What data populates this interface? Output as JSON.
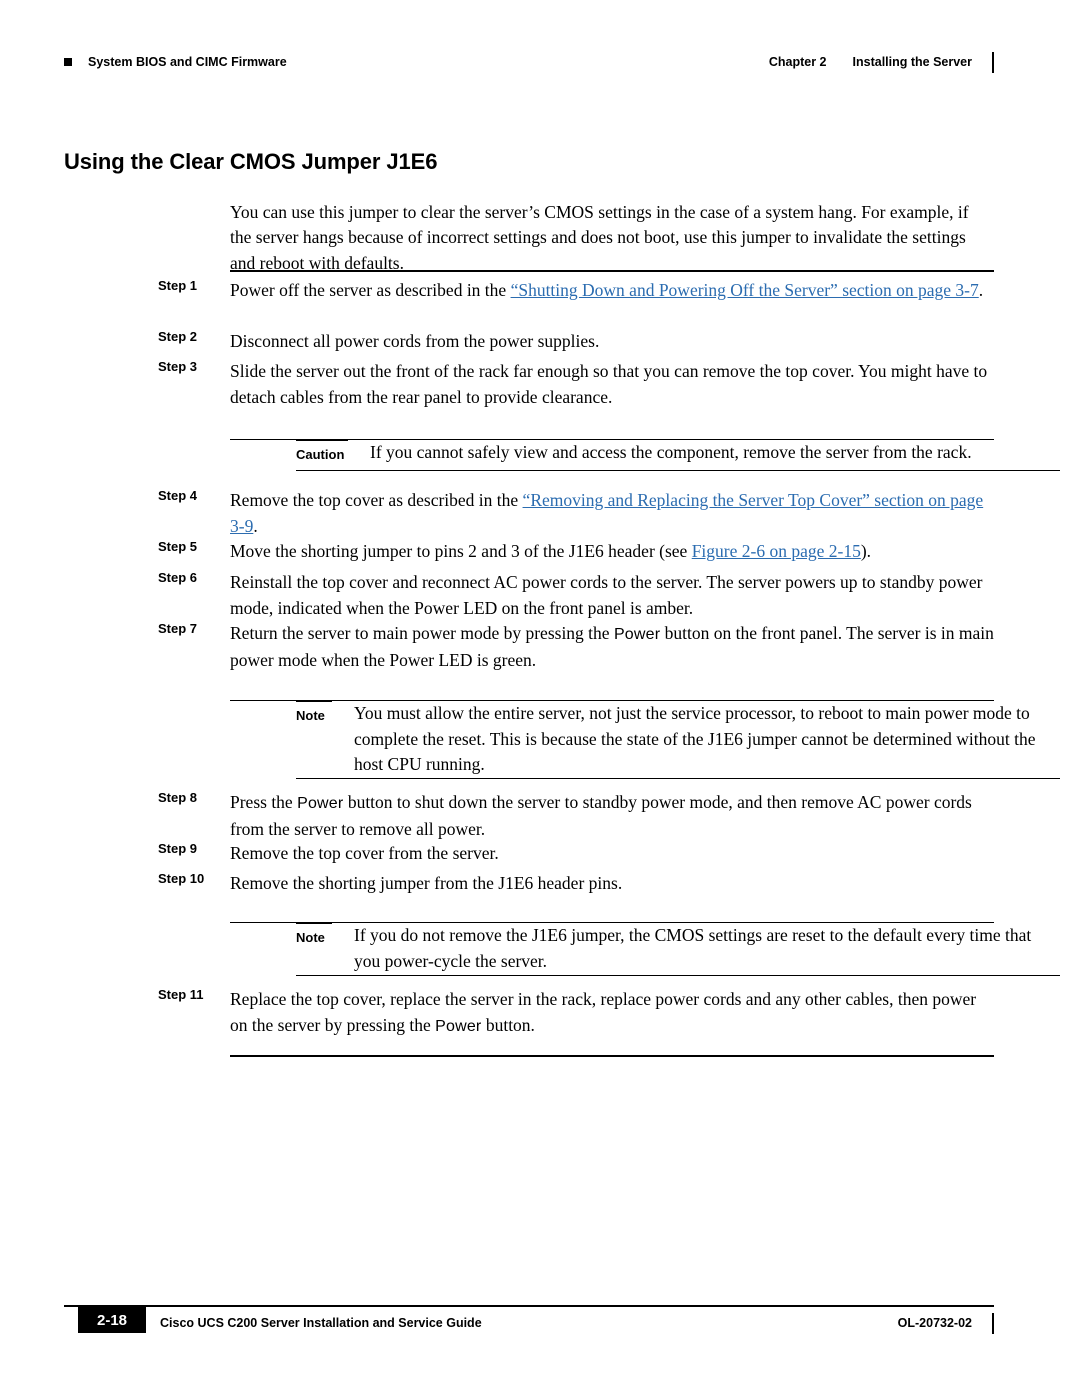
{
  "header": {
    "left_text": "System BIOS and CIMC Firmware",
    "chapter": "Chapter 2",
    "chapter_title": "Installing the Server"
  },
  "title": "Using the Clear CMOS Jumper J1E6",
  "intro": "You can use this jumper to clear the server’s CMOS settings in the case of a system hang. For example, if the server hangs because of incorrect settings and does not boot, use this jumper to invalidate the settings and reboot with defaults.",
  "steps": [
    {
      "label": "Step 1",
      "text_before": "Power off the server as described in the ",
      "link": "“Shutting Down and Powering Off the Server” section on page 3-7",
      "text_after": "."
    },
    {
      "label": "Step 2",
      "text_before": "Disconnect all power cords from the power supplies.",
      "link": "",
      "text_after": ""
    },
    {
      "label": "Step 3",
      "text_before": "Slide the server out the front of the rack far enough so that you can remove the top cover. You might have to detach cables from the rear panel to provide clearance.",
      "link": "",
      "text_after": ""
    },
    {
      "label": "Step 4",
      "text_before": "Remove the top cover as described in the ",
      "link": "“Removing and Replacing the Server Top Cover” section on page 3-9",
      "text_after": "."
    },
    {
      "label": "Step 5",
      "text_before": "Move the shorting jumper to pins 2 and 3 of the J1E6 header (see ",
      "link": "Figure 2-6 on page 2-15",
      "text_after": ")."
    },
    {
      "label": "Step 6",
      "text_before": "Reinstall the top cover and reconnect AC power cords to the server. The server powers up to standby power mode, indicated when the Power LED on the front panel is amber.",
      "link": "",
      "text_after": ""
    },
    {
      "label": "Step 7",
      "text_before": "Return the server to main power mode by pressing the ",
      "ui_label": "Power",
      "text_after": " button on the front panel. The server is in main power mode when the Power LED is green."
    },
    {
      "label": "Step 8",
      "text_before": "Press the ",
      "ui_label": "Power",
      "text_after": " button to shut down the server to standby power mode, and then remove AC power cords from the server to remove all power."
    },
    {
      "label": "Step 9",
      "text_before": "Remove the top cover from the server.",
      "link": "",
      "text_after": ""
    },
    {
      "label": "Step 10",
      "text_before": "Remove the shorting jumper from the J1E6 header pins.",
      "link": "",
      "text_after": ""
    },
    {
      "label": "Step 11",
      "text_before": "Replace the top cover, replace the server in the rack, replace power cords and any other cables, then power on the server by pressing the ",
      "ui_label": "Power",
      "text_after": " button."
    }
  ],
  "admonitions": {
    "caution": {
      "label": "Caution",
      "text": "If you cannot safely view and access the component, remove the server from the rack."
    },
    "note1": {
      "label": "Note",
      "text": "You must allow the entire server, not just the service processor, to reboot to main power mode to complete the reset. This is because the state of the J1E6 jumper cannot be determined without the host CPU running."
    },
    "note2": {
      "label": "Note",
      "text": "If you do not remove the J1E6 jumper, the CMOS settings are reset to the default every time that you power-cycle the server."
    }
  },
  "footer": {
    "guide_title": "Cisco UCS C200 Server Installation and Service Guide",
    "doc_id": "OL-20732-02",
    "page_number": "2-18"
  }
}
